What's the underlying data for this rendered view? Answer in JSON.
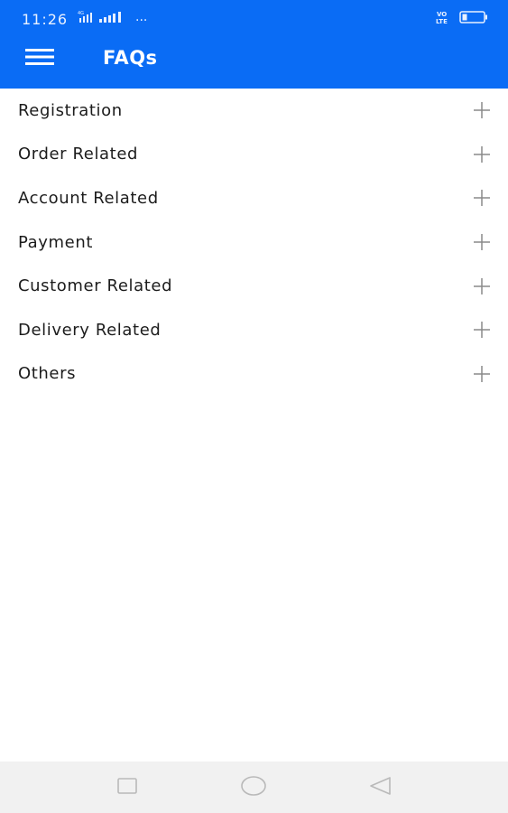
{
  "status_bar": {
    "time": "11:26",
    "more_indicator": "···",
    "volte_label": "VO\nLTE"
  },
  "toolbar": {
    "title": "FAQs",
    "menu_icon": "hamburger-menu-icon"
  },
  "faq": {
    "items": [
      {
        "label": "Registration",
        "icon": "plus-icon"
      },
      {
        "label": "Order Related",
        "icon": "plus-icon"
      },
      {
        "label": "Account Related",
        "icon": "plus-icon"
      },
      {
        "label": "Payment",
        "icon": "plus-icon"
      },
      {
        "label": "Customer Related",
        "icon": "plus-icon"
      },
      {
        "label": "Delivery Related",
        "icon": "plus-icon"
      },
      {
        "label": "Others",
        "icon": "plus-icon"
      }
    ]
  },
  "nav_bar": {
    "buttons": [
      "recents-square-icon",
      "home-circle-icon",
      "back-triangle-icon"
    ]
  },
  "colors": {
    "header": "#0a6cf5",
    "text": "#1c1c1c",
    "icon": "#8a8a8a",
    "nav_bar": "#f1f1f1"
  }
}
